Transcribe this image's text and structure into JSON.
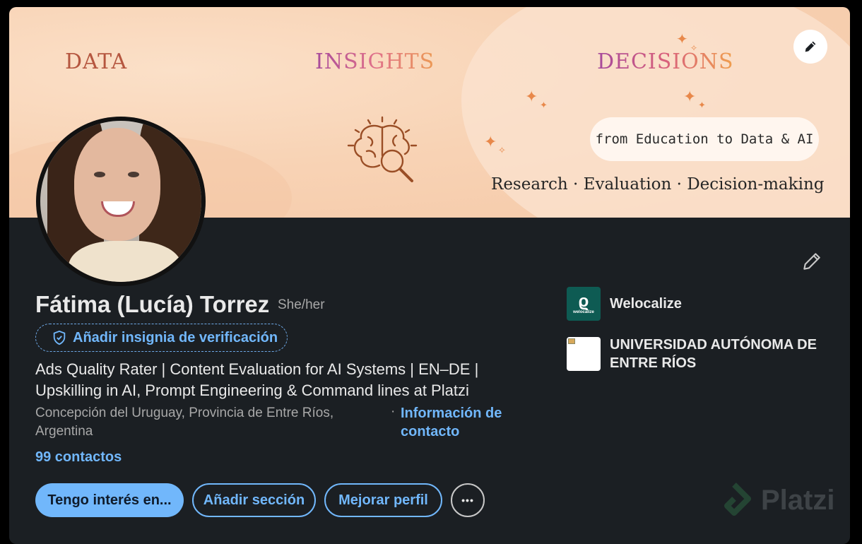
{
  "banner": {
    "word_data": "DATA",
    "word_insights": "INSIGHTS",
    "word_decisions": "DECISIONS",
    "pill_text": "from Education to Data & AI",
    "tagline": "Research · Evaluation · Decision-making",
    "edit_icon": "pencil-icon"
  },
  "profile": {
    "name": "Fátima (Lucía) Torrez",
    "pronouns": "She/her",
    "verify_label": "Añadir insignia de verificación",
    "headline": "Ads Quality Rater | Content Evaluation for AI Systems | EN–DE | Upskilling in AI, Prompt Engineering & Command lines at Platzi",
    "location": "Concepción del Uruguay, Provincia de Entre Ríos, Argentina",
    "separator": "·",
    "contact_info": "Información de contacto",
    "connections": "99 contactos"
  },
  "actions": {
    "interest": "Tengo interés en...",
    "add_section": "Añadir sección",
    "improve_profile": "Mejorar perfil",
    "more": "•••"
  },
  "companies": [
    {
      "name": "Welocalize",
      "logo_text": "welocalize"
    },
    {
      "name": "UNIVERSIDAD AUTÓNOMA DE ENTRE RÍOS"
    }
  ],
  "watermark": {
    "text": "Platzi"
  },
  "colors": {
    "accent": "#71b7fb",
    "card": "#1b1f23",
    "banner": "#f8d3b5"
  }
}
